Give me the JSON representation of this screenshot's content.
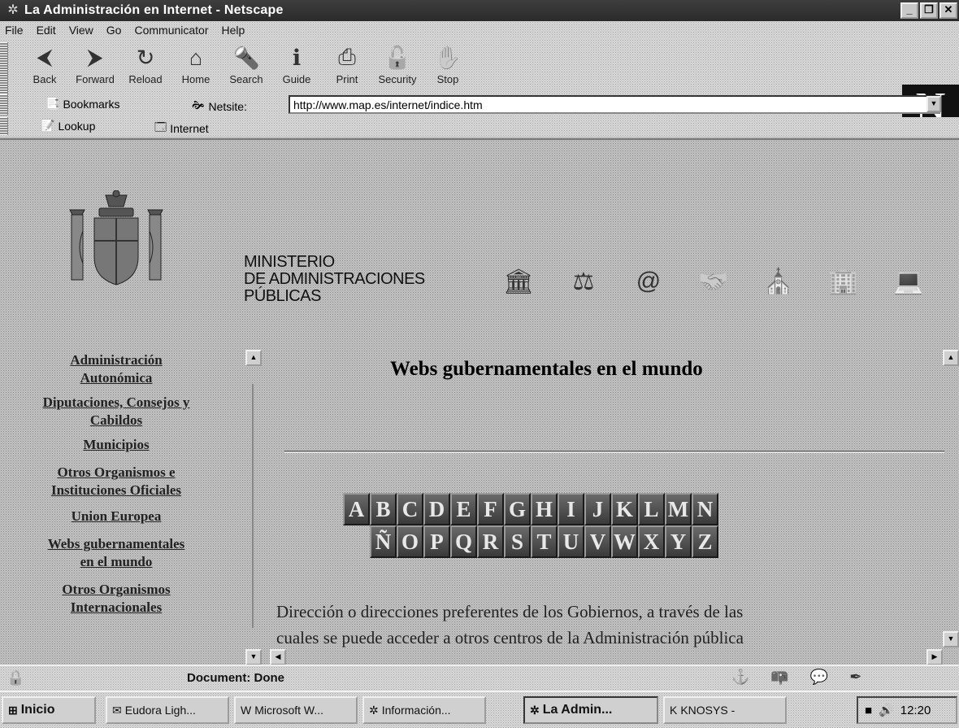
{
  "window": {
    "title": "La Administración en Internet - Netscape",
    "app_icon": "netscape-icon"
  },
  "menu": [
    "File",
    "Edit",
    "View",
    "Go",
    "Communicator",
    "Help"
  ],
  "toolbar": {
    "buttons": [
      {
        "label": "Back",
        "icon": "back-arrow-icon",
        "glyph": "⮜"
      },
      {
        "label": "Forward",
        "icon": "forward-arrow-icon",
        "glyph": "⮞"
      },
      {
        "label": "Reload",
        "icon": "reload-icon",
        "glyph": "↻"
      },
      {
        "label": "Home",
        "icon": "home-icon",
        "glyph": "⌂"
      },
      {
        "label": "Search",
        "icon": "search-icon",
        "glyph": "🔦"
      },
      {
        "label": "Guide",
        "icon": "guide-icon",
        "glyph": "ℹ"
      },
      {
        "label": "Print",
        "icon": "print-icon",
        "glyph": "⎙"
      },
      {
        "label": "Security",
        "icon": "security-lock-icon",
        "glyph": "🔓"
      },
      {
        "label": "Stop",
        "icon": "stop-icon",
        "glyph": "✋"
      }
    ],
    "logo": "N"
  },
  "location": {
    "bookmarks_label": "Bookmarks",
    "netsite_label": "Netsite:",
    "url": "http://www.map.es/internet/indice.htm"
  },
  "personal": {
    "lookup_label": "Lookup",
    "internet_label": "Internet"
  },
  "header": {
    "ministry_lines": [
      "MINISTERIO",
      "DE ADMINISTRACIONES",
      "PÚBLICAS"
    ],
    "icons": [
      "building-icon",
      "person-scale-icon",
      "email-at-icon",
      "handshake-icon",
      "church-icon",
      "government-building-icon",
      "computer-icon"
    ]
  },
  "sidebar": {
    "links": [
      {
        "lines": [
          "Administración",
          "Autonómica"
        ]
      },
      {
        "lines": [
          "Diputaciones, Consejos y",
          "Cabildos"
        ]
      },
      {
        "lines": [
          "Municipios"
        ]
      },
      {
        "lines": [
          "Otros Organismos e",
          "Instituciones Oficiales"
        ]
      },
      {
        "lines": [
          "Union Europea"
        ]
      },
      {
        "lines": [
          "Webs gubernamentales",
          "en el mundo"
        ]
      },
      {
        "lines": [
          "Otros Organismos",
          "Internacionales"
        ]
      }
    ]
  },
  "main": {
    "title": "Webs gubernamentales en el mundo",
    "alphabet_row1": [
      "A",
      "B",
      "C",
      "D",
      "E",
      "F",
      "G",
      "H",
      "I",
      "J",
      "K",
      "L",
      "M",
      "N"
    ],
    "alphabet_row2": [
      "Ñ",
      "O",
      "P",
      "Q",
      "R",
      "S",
      "T",
      "U",
      "V",
      "W",
      "X",
      "Y",
      "Z"
    ],
    "intro_line1": "Dirección o direcciones preferentes de los Gobiernos, a través de las",
    "intro_line2": "cuales se puede acceder a otros centros de la Administración pública"
  },
  "status": {
    "text": "Document: Done"
  },
  "taskbar": {
    "start_label": "Inicio",
    "tasks": [
      {
        "label": "Eudora Ligh...",
        "icon": "eudora-icon"
      },
      {
        "label": "Microsoft W...",
        "icon": "word-icon"
      },
      {
        "label": "Información...",
        "icon": "netscape-icon"
      },
      {
        "label": "La Admin...",
        "icon": "netscape-icon",
        "active": true
      },
      {
        "label": "KNOSYS -",
        "icon": "knosys-icon"
      }
    ],
    "clock": "12:20"
  }
}
